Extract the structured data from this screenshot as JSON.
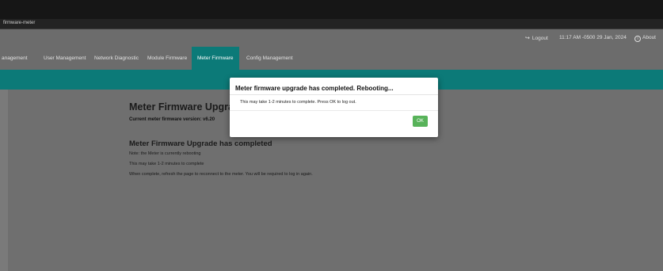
{
  "window": {
    "title": "firmware-meter"
  },
  "header": {
    "logout_label": "Logout",
    "logout_icon": "logout-icon",
    "datetime": "11:17 AM -0500 29 Jan, 2024",
    "about_label": "About",
    "about_icon": "info-icon"
  },
  "nav": {
    "tabs": [
      {
        "label": "anagement"
      },
      {
        "label": "User Management"
      },
      {
        "label": "Network Diagnostic"
      },
      {
        "label": "Module Firmware"
      },
      {
        "label": "Meter Firmware",
        "active": true
      },
      {
        "label": "Config Management"
      }
    ]
  },
  "main": {
    "title": "Meter Firmware Upgrade",
    "current_version": "Current meter firmware version: v6.20",
    "status_heading": "Meter Firmware Upgrade has completed",
    "lines": [
      "Note: the Meter is currently rebooting",
      "This may take 1-2 minutes to complete",
      "When complete, refresh the page to reconnect to the meter. You will be required to log in again."
    ]
  },
  "modal": {
    "title": "Meter firmware upgrade has completed. Rebooting...",
    "body": "This may take 1-2 minutes to complete. Press OK to log out.",
    "ok_label": "OK"
  },
  "colors": {
    "accent_teal": "#0c7a78",
    "ok_green": "#58b35a"
  }
}
